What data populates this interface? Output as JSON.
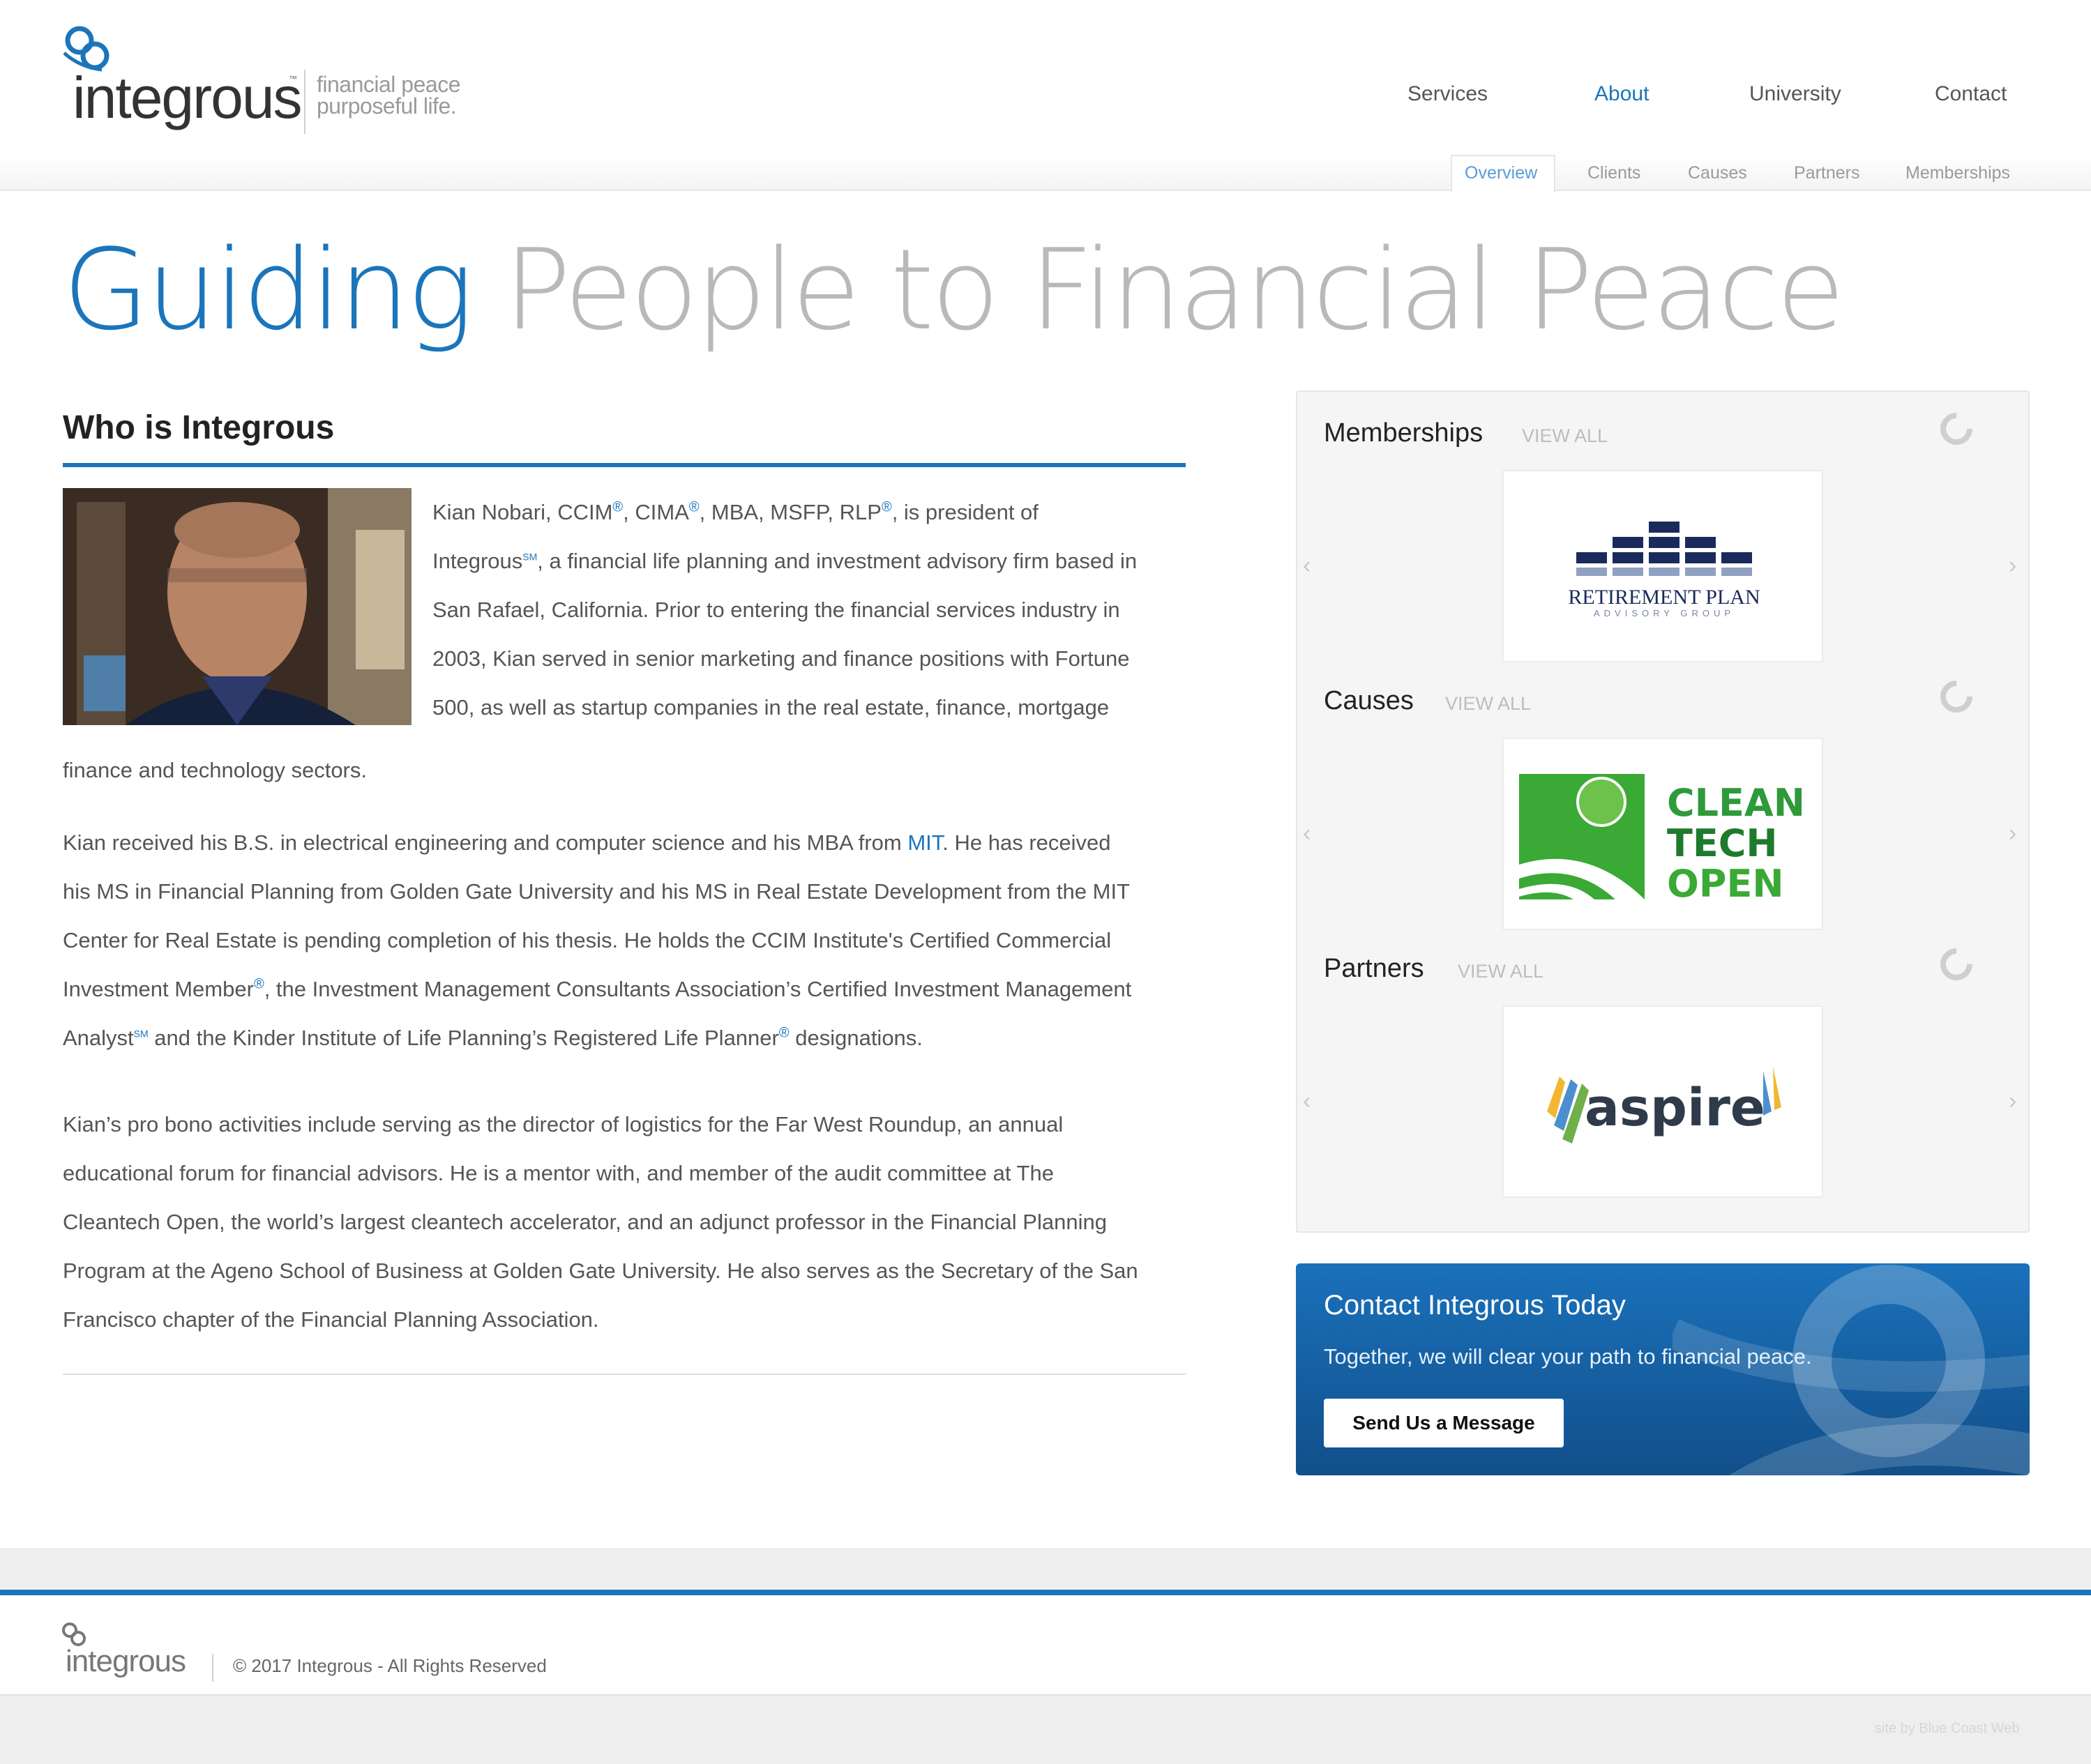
{
  "header": {
    "logo_word": "integrous",
    "logo_tm": "™",
    "tagline_1": "financial peace",
    "tagline_2": "purposeful life.",
    "nav": [
      "Services",
      "About",
      "University",
      "Contact"
    ],
    "subnav": [
      "Overview",
      "Clients",
      "Causes",
      "Partners",
      "Memberships"
    ]
  },
  "hero": {
    "part1": "Guiding",
    "part2": "People to Financial Peace"
  },
  "main": {
    "heading": "Who is Integrous",
    "p1_l1a": "Kian Nobari, CCIM",
    "p1_l1b": ", CIMA",
    "p1_l1c": ", MBA, MSFP, RLP",
    "p1_l1d": ", is president of",
    "p1_l2a": "Integrous",
    "p1_l2b": ", a financial life planning and investment advisory firm based in",
    "p1_l3": "San Rafael, California. Prior to entering the financial services industry in",
    "p1_l4": "2003, Kian served in senior marketing and finance positions with Fortune",
    "p1_l5": "500, as well as startup companies in the real estate, finance, mortgage",
    "p1_l6": "finance and technology sectors.",
    "p2_l1a": "Kian received his B.S. in electrical engineering and computer science and his MBA from ",
    "p2_l1_link": "MIT",
    "p2_l1b": ". He has received",
    "p2_l2": "his MS in Financial Planning from Golden Gate University and his MS in Real Estate Development from the MIT",
    "p2_l3": "Center for Real Estate is pending completion of his thesis. He holds the CCIM Institute's Certified Commercial",
    "p2_l4a": "Investment Member",
    "p2_l4b": ", the Investment Management Consultants Association’s Certified Investment Management",
    "p2_l5a": "Analyst",
    "p2_l5b": " and the Kinder Institute of Life Planning’s Registered Life Planner",
    "p2_l5c": " designations.",
    "p3_l1": "Kian’s pro bono activities include serving as the director of logistics for the Far West Roundup, an annual",
    "p3_l2": "educational forum for financial advisors. He is a mentor with, and member of the audit committee at The",
    "p3_l3": "Cleantech Open, the world’s largest cleantech accelerator, and an adjunct professor in the Financial Planning",
    "p3_l4": "Program at the Ageno School of Business at Golden Gate University. He also serves as the Secretary of the San",
    "p3_l5": "Francisco chapter of the Financial Planning Association.",
    "reg": "®",
    "sm": "SM"
  },
  "sidebar": {
    "view_all": "VIEW ALL",
    "sections": [
      "Memberships",
      "Causes",
      "Partners"
    ],
    "rpag_line1": "RETIREMENT PLAN",
    "rpag_line2": "ADVISORY GROUP",
    "cto_line1": "CLEAN",
    "cto_line2": "TECH",
    "cto_line3": "OPEN",
    "aspire": "aspire",
    "arrow_left": "‹",
    "arrow_right": "›"
  },
  "contact": {
    "title": "Contact Integrous Today",
    "text": "Together, we will clear your path to financial peace.",
    "button": "Send Us a Message"
  },
  "footer": {
    "logo_word": "integrous",
    "copyright": "© 2017 Integrous - All Rights Reserved",
    "credit": "site by Blue Coast Web"
  },
  "colors": {
    "brand_blue": "#1b75bb",
    "hero_grey": "#b9b9b9"
  }
}
